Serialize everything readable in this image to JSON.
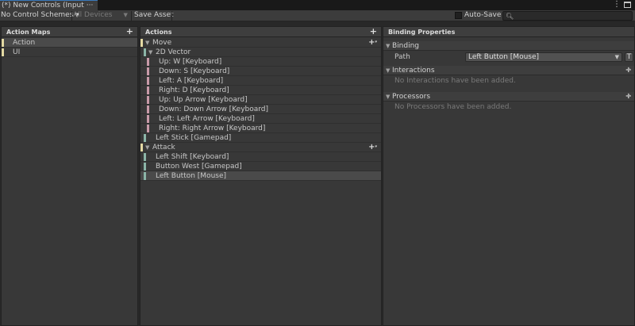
{
  "window": {
    "tab_title": "(*) New Controls (Input",
    "tab_more": "···",
    "menu_icon": "kebab-menu-icon",
    "maximize_icon": "maximize-icon"
  },
  "toolbar": {
    "control_schemes": "No Control Schemes",
    "devices": "All Devices",
    "save_asset": "Save Asset",
    "auto_save_label": "Auto-Save",
    "auto_save_checked": false,
    "search_placeholder": ""
  },
  "action_maps": {
    "header": "Action Maps",
    "items": [
      {
        "label": "Action",
        "selected": true
      },
      {
        "label": "UI",
        "selected": false
      }
    ]
  },
  "actions": {
    "header": "Actions",
    "rows": [
      {
        "label": "Move"
      },
      {
        "label": "2D Vector"
      },
      {
        "label": "Up: W [Keyboard]"
      },
      {
        "label": "Down: S [Keyboard]"
      },
      {
        "label": "Left: A [Keyboard]"
      },
      {
        "label": "Right: D [Keyboard]"
      },
      {
        "label": "Up: Up Arrow [Keyboard]"
      },
      {
        "label": "Down: Down Arrow [Keyboard]"
      },
      {
        "label": "Left: Left Arrow [Keyboard]"
      },
      {
        "label": "Right: Right Arrow [Keyboard]"
      },
      {
        "label": "Left Stick [Gamepad]"
      },
      {
        "label": "Attack"
      },
      {
        "label": "Left Shift [Keyboard]"
      },
      {
        "label": "Button West [Gamepad]"
      },
      {
        "label": "Left Button [Mouse]"
      }
    ]
  },
  "properties": {
    "header": "Binding Properties",
    "binding_section": "Binding",
    "path_label": "Path",
    "path_value": "Left Button [Mouse]",
    "t_button": "T",
    "interactions_section": "Interactions",
    "interactions_empty": "No Interactions have been added.",
    "processors_section": "Processors",
    "processors_empty": "No Processors have been added."
  },
  "colors": {
    "action_map_bar": "#e3d9a3",
    "action_bar": "#8bb5a8",
    "composite_part_bar": "#c89aa9",
    "selected_row": "#4a4a4a"
  }
}
